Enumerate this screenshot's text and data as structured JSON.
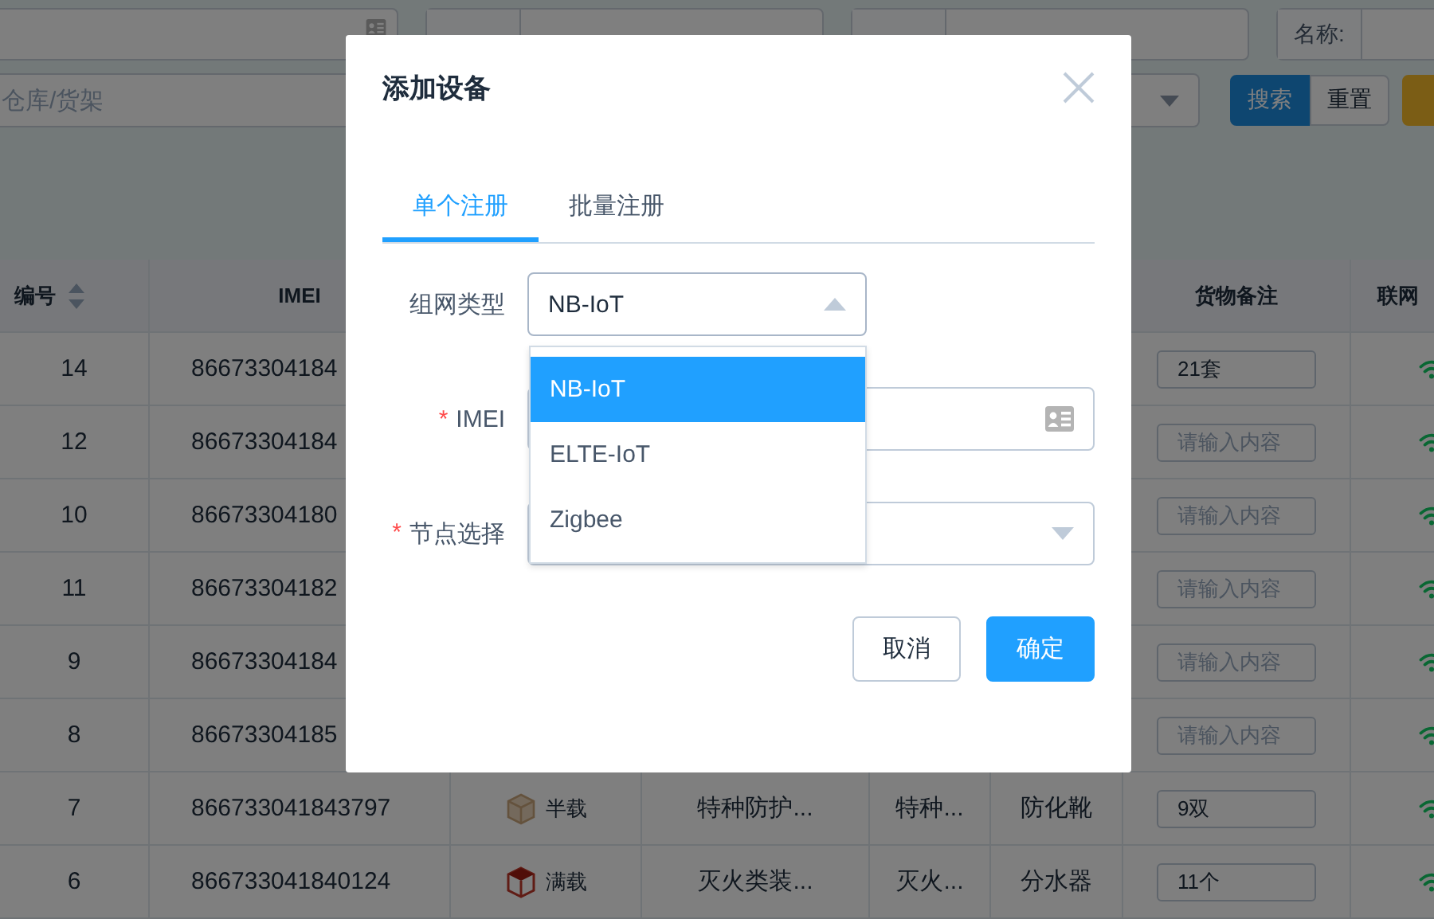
{
  "filters": [
    {
      "kind": "icon"
    },
    {
      "kind": "covered"
    },
    {
      "kind": "covered"
    },
    {
      "kind": "labeled",
      "label": "名称:"
    }
  ],
  "location_field": {
    "placeholder": "仓库/货架"
  },
  "actions": [
    {
      "label": "搜索",
      "kind": "primary"
    },
    {
      "label": "重置",
      "kind": "default"
    },
    {
      "kind": "warning"
    }
  ],
  "table": {
    "columns": [
      {
        "label": "编号",
        "sortable": true
      },
      {
        "label": "IMEI"
      },
      {
        "label": "货物备注"
      },
      {
        "label": "联网"
      }
    ],
    "rows": [
      {
        "id": "14",
        "imei": "86673304184",
        "note": "21套",
        "online": true
      },
      {
        "id": "12",
        "imei": "86673304184",
        "note_placeholder": "请输入内容",
        "online": true
      },
      {
        "id": "10",
        "imei": "86673304180",
        "note_placeholder": "请输入内容",
        "online": true
      },
      {
        "id": "11",
        "imei": "86673304182",
        "note_placeholder": "请输入内容",
        "online": true
      },
      {
        "id": "9",
        "imei": "86673304184",
        "note_placeholder": "请输入内容",
        "online": true
      },
      {
        "id": "8",
        "imei": "86673304185",
        "note_placeholder": "请输入内容",
        "online": true
      },
      {
        "id": "7",
        "imei": "866733041843797",
        "full": false,
        "load_label": "半载",
        "category": "特种防护...",
        "type": "特种...",
        "name": "防化靴",
        "note": "9双",
        "online": true
      },
      {
        "id": "6",
        "imei": "866733041840124",
        "full": true,
        "load_label": "满载",
        "category": "灭火类装...",
        "type": "灭火...",
        "name": "分水器",
        "note": "11个",
        "online": true
      }
    ]
  },
  "dialog": {
    "title": "添加设备",
    "tabs": [
      {
        "label": "单个注册",
        "selected": true
      },
      {
        "label": "批量注册",
        "selected": false
      }
    ],
    "fields": [
      {
        "kind": "select",
        "label": "组网类型",
        "value": "NB-IoT",
        "expanded": true
      },
      {
        "kind": "input",
        "label": "IMEI",
        "required_mark": "*"
      },
      {
        "kind": "select",
        "label": "节点选择",
        "required_mark": "*",
        "expanded": false
      }
    ],
    "dropdown_options": [
      {
        "label": "NB-IoT",
        "selected": true
      },
      {
        "label": "ELTE-IoT",
        "selected": false
      },
      {
        "label": "Zigbee",
        "selected": false
      }
    ],
    "buttons": [
      {
        "label": "取消",
        "kind": "default"
      },
      {
        "label": "确定",
        "kind": "primary"
      }
    ]
  }
}
